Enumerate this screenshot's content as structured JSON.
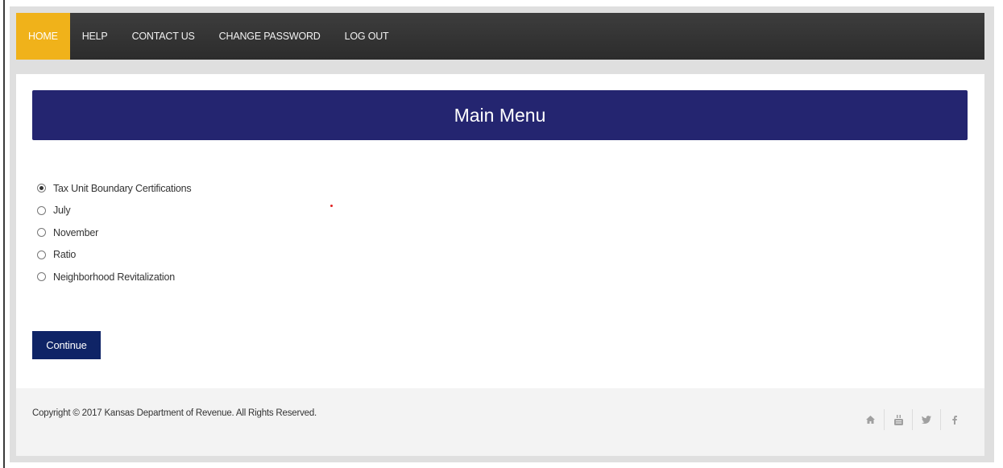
{
  "nav": {
    "items": [
      {
        "label": "HOME"
      },
      {
        "label": "HELP"
      },
      {
        "label": "CONTACT US"
      },
      {
        "label": "CHANGE PASSWORD"
      },
      {
        "label": "LOG OUT"
      }
    ],
    "active_index": 0,
    "active_color": "#f0b21a",
    "bar_color": "#333333"
  },
  "main": {
    "title": "Main Menu",
    "banner_color": "#242570",
    "options": [
      {
        "label": "Tax Unit Boundary Certifications",
        "checked": true
      },
      {
        "label": "July",
        "checked": false
      },
      {
        "label": "November",
        "checked": false
      },
      {
        "label": "Ratio",
        "checked": false
      },
      {
        "label": "Neighborhood Revitalization",
        "checked": false
      }
    ],
    "continue_label": "Continue",
    "button_color": "#0f2466"
  },
  "footer": {
    "copyright": "Copyright © 2017 Kansas Department of Revenue. All Rights Reserved.",
    "socials": [
      {
        "icon": "home-icon"
      },
      {
        "icon": "youtube-icon"
      },
      {
        "icon": "twitter-icon"
      },
      {
        "icon": "facebook-icon"
      }
    ]
  }
}
